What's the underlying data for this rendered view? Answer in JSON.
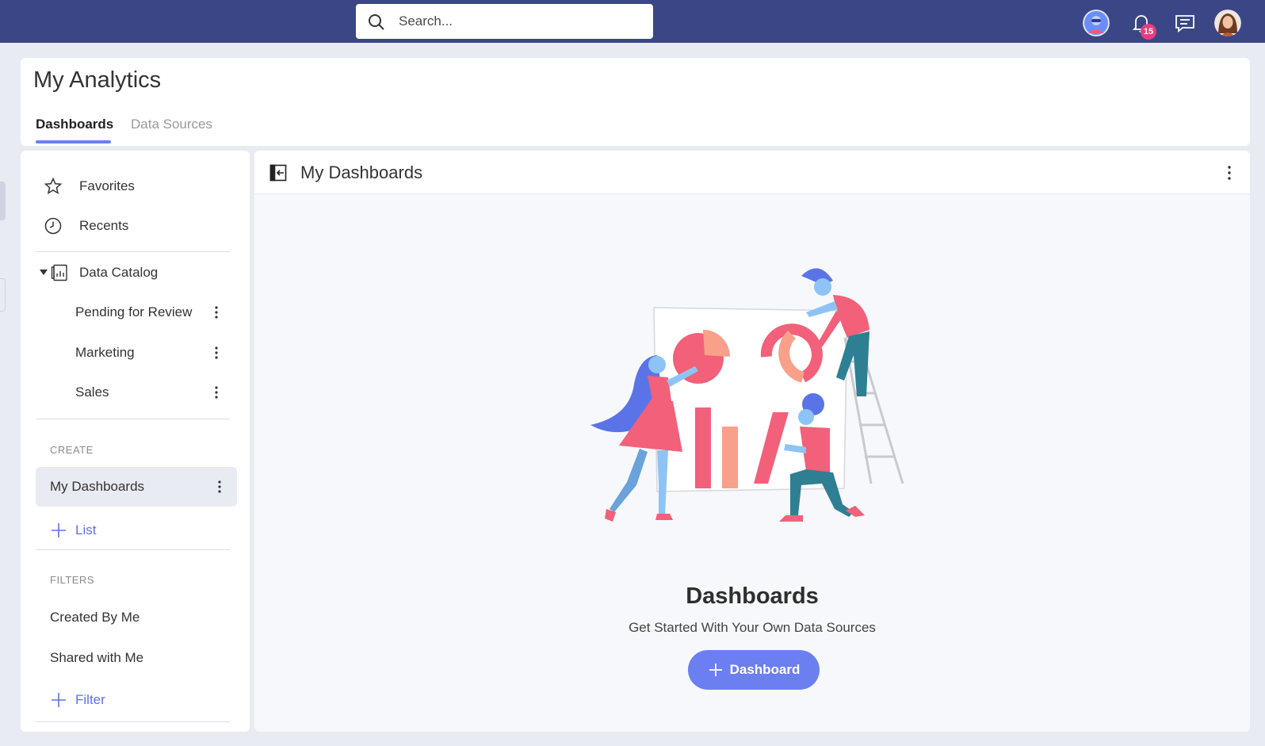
{
  "search": {
    "placeholder": "Search..."
  },
  "topbar": {
    "notifications_count": "15",
    "icons": [
      "search-icon",
      "bot-avatar",
      "bell-icon",
      "chat-icon",
      "user-avatar"
    ]
  },
  "page": {
    "title": "My Analytics",
    "tabs": [
      {
        "label": "Dashboards",
        "active": true
      },
      {
        "label": "Data Sources",
        "active": false
      }
    ]
  },
  "sidebar": {
    "favorites": "Favorites",
    "recents": "Recents",
    "data_catalog": "Data Catalog",
    "catalog_items": [
      {
        "label": "Pending for Review"
      },
      {
        "label": "Marketing"
      },
      {
        "label": "Sales"
      }
    ],
    "create_title": "CREATE",
    "my_dashboards": "My Dashboards",
    "add_list": "List",
    "filters_title": "FILTERS",
    "filters": [
      {
        "label": "Created By Me"
      },
      {
        "label": "Shared with Me"
      }
    ],
    "add_filter": "Filter"
  },
  "main": {
    "title": "My Dashboards",
    "empty_title": "Dashboards",
    "empty_subtitle": "Get Started With Your Own Data Sources",
    "cta_label": "Dashboard"
  },
  "colors": {
    "topbar": "#3b4687",
    "accent": "#6b7ff0",
    "badge": "#e93d7d",
    "coral": "#f2607a"
  }
}
